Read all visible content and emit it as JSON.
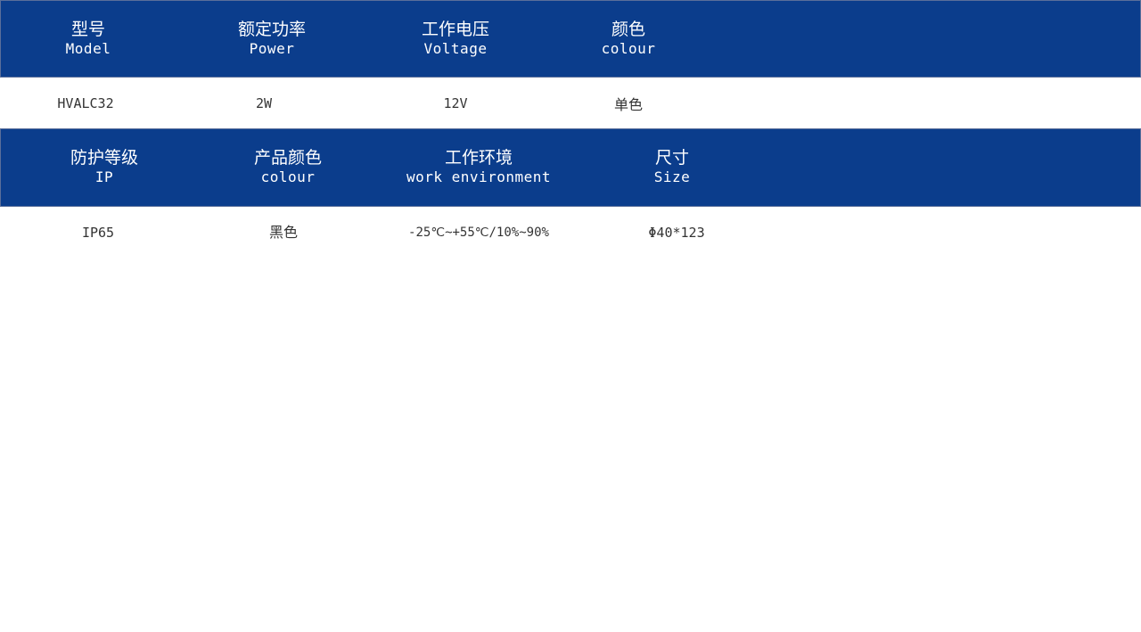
{
  "theme": {
    "header_bg": "#0b3d8c",
    "header_text": "#ffffff",
    "value_text": "#333333",
    "page_bg": "#ffffff"
  },
  "table1": {
    "headers": [
      {
        "zh": "型号",
        "en": "Model"
      },
      {
        "zh": "额定功率",
        "en": "Power"
      },
      {
        "zh": "工作电压",
        "en": "Voltage"
      },
      {
        "zh": "颜色",
        "en": "colour"
      }
    ],
    "values": [
      "HVALC32",
      "2W",
      "12V",
      "单色"
    ]
  },
  "table2": {
    "headers": [
      {
        "zh": "防护等级",
        "en": "IP"
      },
      {
        "zh": "产品颜色",
        "en": "colour"
      },
      {
        "zh": "工作环境",
        "en": "work environment"
      },
      {
        "zh": "尺寸",
        "en": "Size"
      }
    ],
    "values": [
      "IP65",
      "黑色",
      "-25℃~+55℃/10%~90%",
      "Φ40*123"
    ]
  }
}
